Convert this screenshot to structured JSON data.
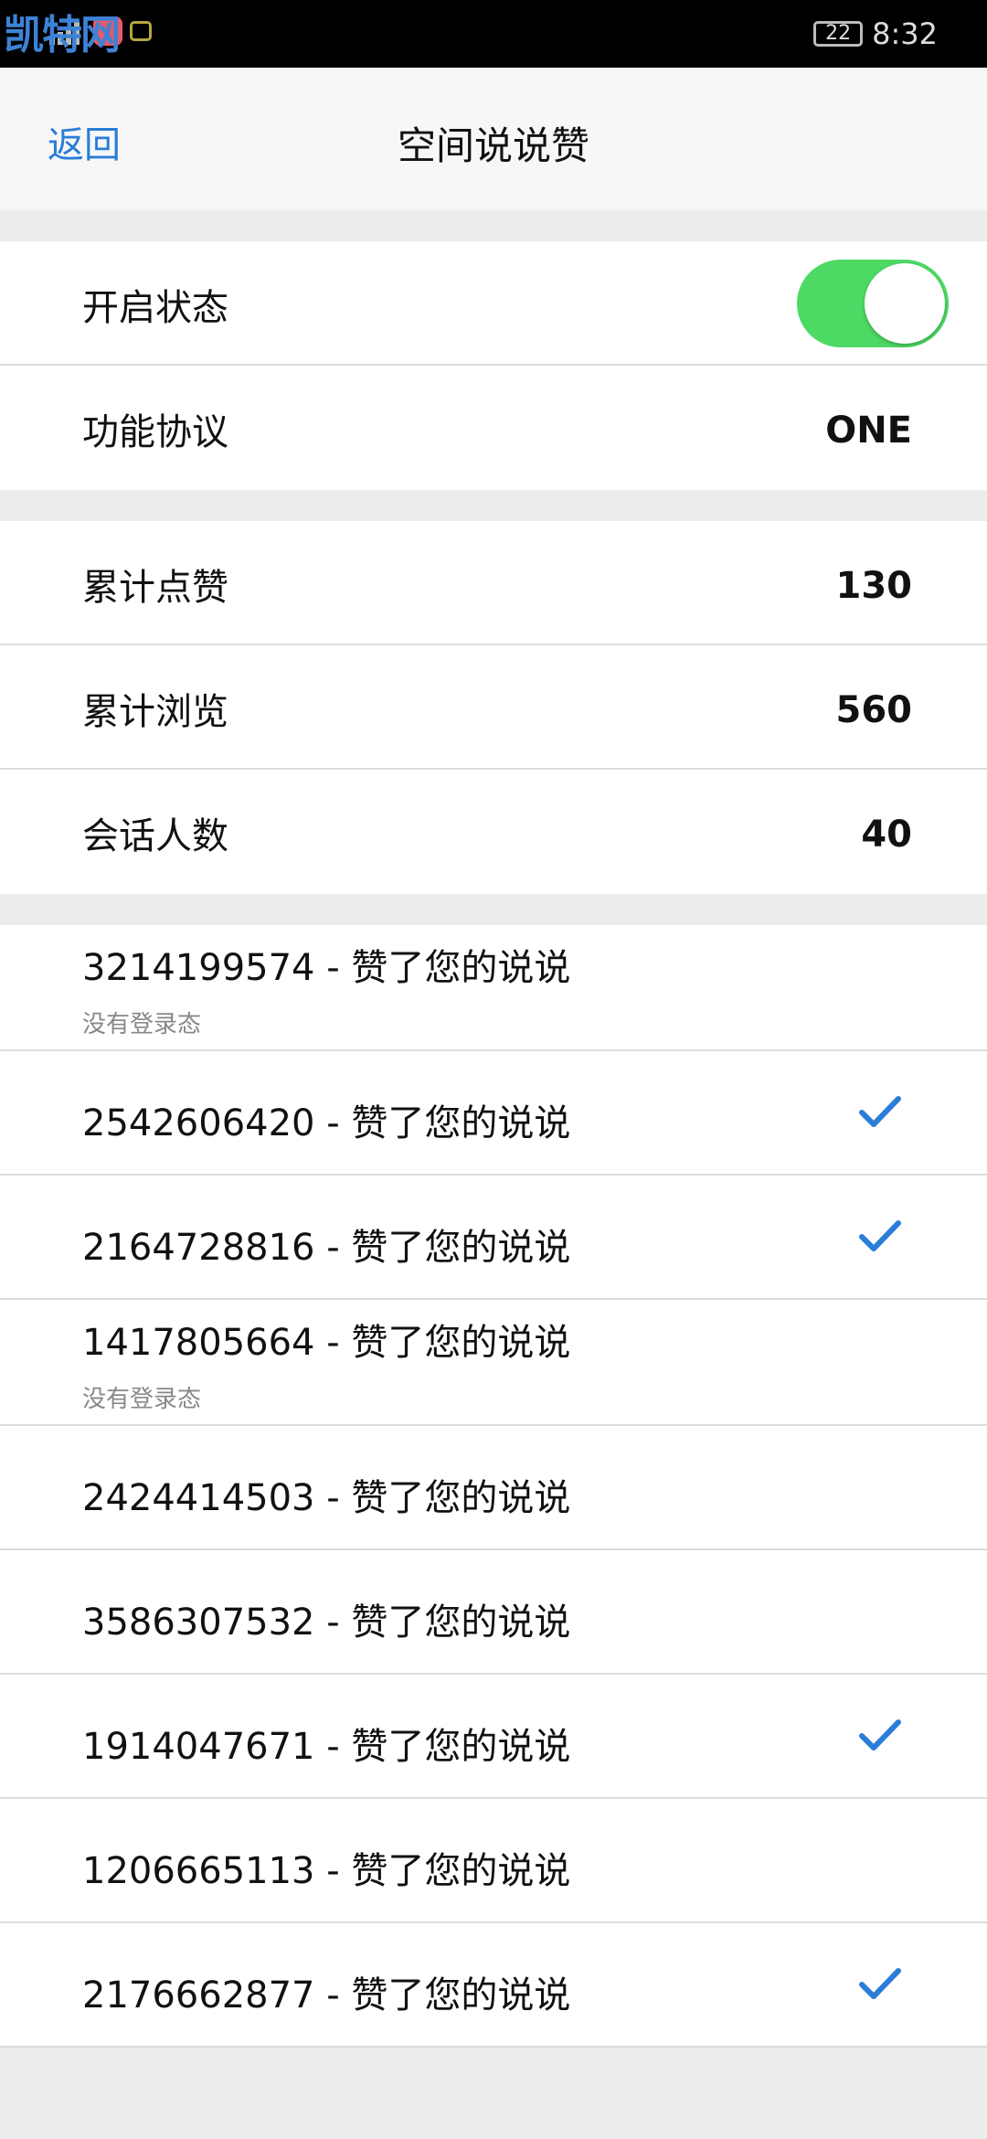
{
  "watermark": "凯特网",
  "status_bar": {
    "battery": "22",
    "time": "8:32",
    "signal_icon": "signal-icon",
    "app_icon": "app-icon"
  },
  "nav": {
    "back": "返回",
    "title": "空间说说赞"
  },
  "settings": {
    "enabled_label": "开启状态",
    "enabled": true,
    "protocol_label": "功能协议",
    "protocol_value": "ONE"
  },
  "stats": [
    {
      "label": "累计点赞",
      "value": "130"
    },
    {
      "label": "累计浏览",
      "value": "560"
    },
    {
      "label": "会话人数",
      "value": "40"
    }
  ],
  "colors": {
    "accent": "#2a7dd8",
    "toggle_on": "#4cd964",
    "check": "#2a7dd8"
  },
  "list": [
    {
      "text": "3214199574 - 赞了您的说说",
      "sub": "没有登录态",
      "checked": false
    },
    {
      "text": "2542606420 - 赞了您的说说",
      "sub": "",
      "checked": true
    },
    {
      "text": "2164728816 - 赞了您的说说",
      "sub": "",
      "checked": true
    },
    {
      "text": "1417805664 - 赞了您的说说",
      "sub": "没有登录态",
      "checked": false
    },
    {
      "text": "2424414503 - 赞了您的说说",
      "sub": "",
      "checked": false
    },
    {
      "text": "3586307532 - 赞了您的说说",
      "sub": "",
      "checked": false
    },
    {
      "text": "1914047671 - 赞了您的说说",
      "sub": "",
      "checked": true
    },
    {
      "text": "1206665113 - 赞了您的说说",
      "sub": "",
      "checked": false
    },
    {
      "text": "2176662877 - 赞了您的说说",
      "sub": "",
      "checked": true
    }
  ]
}
